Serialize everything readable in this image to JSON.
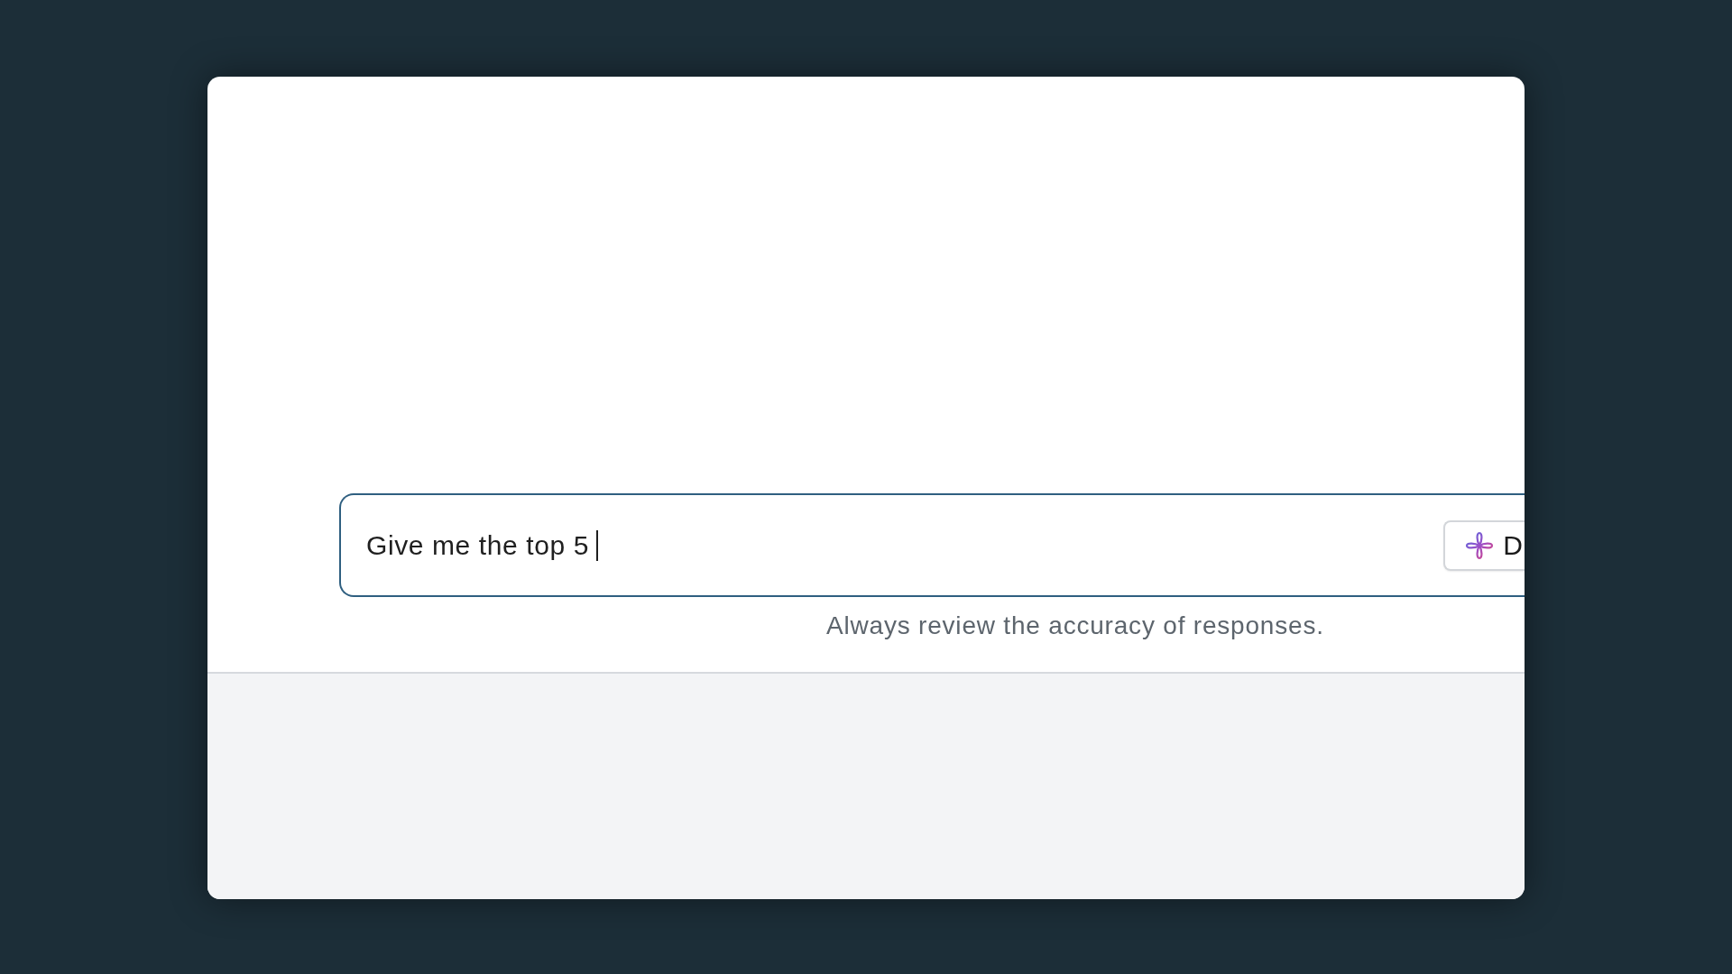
{
  "chat_input": {
    "value": "Give me the top 5",
    "focused": true,
    "button": {
      "label": "D"
    }
  },
  "disclaimer": "Always review the accuracy of responses."
}
